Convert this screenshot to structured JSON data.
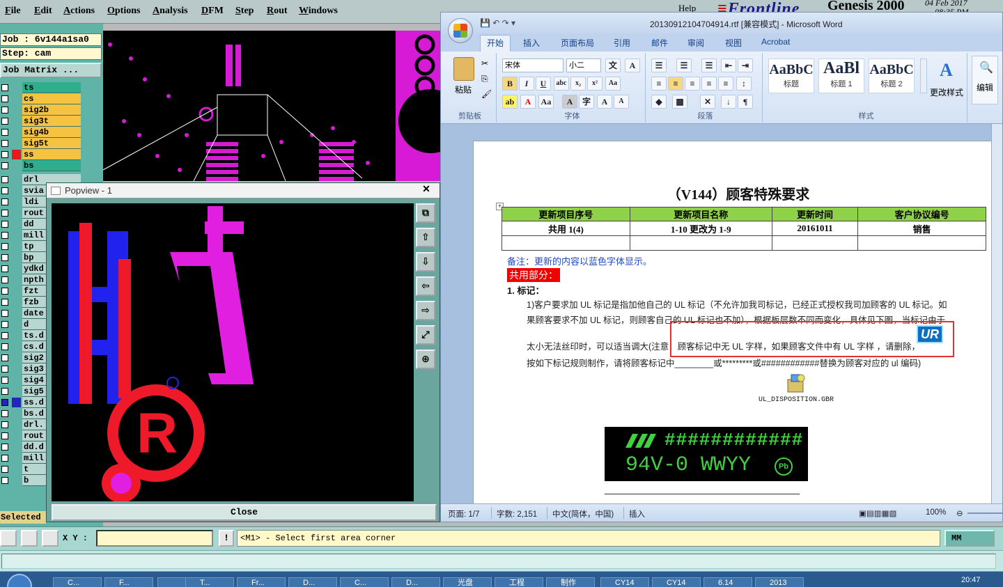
{
  "genesis": {
    "menu": [
      "File",
      "Edit",
      "Actions",
      "Options",
      "Analysis",
      "DFM",
      "Step",
      "Rout",
      "Windows"
    ],
    "brand": {
      "help": "Help",
      "logo": "Frontline",
      "product": "Genesis 2000",
      "date": "04 Feb 2017",
      "time": "08:35 PM"
    },
    "job_label": "Job : 6v144a1sa0",
    "step_label": "Step: cam",
    "job_matrix_button": "Job Matrix ...",
    "layers": [
      {
        "name": "ts",
        "color": "#2fae8e",
        "checked": false
      },
      {
        "name": "cs",
        "color": "#f5c242",
        "checked": false
      },
      {
        "name": "sig2b",
        "color": "#f5c242",
        "checked": false
      },
      {
        "name": "sig3t",
        "color": "#f5c242",
        "checked": false
      },
      {
        "name": "sig4b",
        "color": "#f5c242",
        "checked": false
      },
      {
        "name": "sig5t",
        "color": "#f5c242",
        "checked": false
      },
      {
        "name": "ss",
        "color": "#f5c242",
        "checked": false,
        "highlight": "#e81919"
      },
      {
        "name": "bs",
        "color": "#2fae8e",
        "checked": false
      },
      {
        "name": "drl",
        "color": "#b9d6d0",
        "checked": false
      },
      {
        "name": "svia",
        "color": "#b9d6d0",
        "checked": false
      },
      {
        "name": "ldi",
        "color": "#b9d6d0",
        "checked": false
      },
      {
        "name": "rout",
        "color": "#b9d6d0",
        "checked": false
      },
      {
        "name": "dd",
        "color": "#b9d6d0",
        "checked": false
      },
      {
        "name": "mill",
        "color": "#b9d6d0",
        "checked": false
      },
      {
        "name": "tp",
        "color": "#b9d6d0",
        "checked": false
      },
      {
        "name": "bp",
        "color": "#b9d6d0",
        "checked": false
      },
      {
        "name": "ydkd",
        "color": "#b9d6d0",
        "checked": false
      },
      {
        "name": "npth",
        "color": "#b9d6d0",
        "checked": false
      },
      {
        "name": "fzt",
        "color": "#b9d6d0",
        "checked": false
      },
      {
        "name": "fzb",
        "color": "#b9d6d0",
        "checked": false
      },
      {
        "name": "date",
        "color": "#b9d6d0",
        "checked": false
      },
      {
        "name": "d",
        "color": "#b9d6d0",
        "checked": false
      },
      {
        "name": "ts.d",
        "color": "#b9d6d0",
        "checked": false
      },
      {
        "name": "cs.d",
        "color": "#b9d6d0",
        "checked": false
      },
      {
        "name": "sig2",
        "color": "#b9d6d0",
        "checked": false
      },
      {
        "name": "sig3",
        "color": "#b9d6d0",
        "checked": false
      },
      {
        "name": "sig4",
        "color": "#b9d6d0",
        "checked": false
      },
      {
        "name": "sig5",
        "color": "#b9d6d0",
        "checked": false
      },
      {
        "name": "ss.d",
        "color": "#b9d6d0",
        "checked": true,
        "highlight": "#2424c0"
      },
      {
        "name": "bs.d",
        "color": "#b9d6d0",
        "checked": false
      },
      {
        "name": "drl.",
        "color": "#b9d6d0",
        "checked": false
      },
      {
        "name": "rout",
        "color": "#b9d6d0",
        "checked": false
      },
      {
        "name": "dd.d",
        "color": "#b9d6d0",
        "checked": false
      },
      {
        "name": "mill",
        "color": "#b9d6d0",
        "checked": false
      },
      {
        "name": "t",
        "color": "#b9d6d0",
        "checked": false
      },
      {
        "name": "b",
        "color": "#b9d6d0",
        "checked": false
      }
    ],
    "selected_label": "Selected",
    "popview": {
      "title": "Popview - 1",
      "close_label": "Close",
      "tools": [
        "fit-icon",
        "pan-up-icon",
        "pan-down-icon",
        "pan-left-icon",
        "pan-right-icon",
        "zoom-fit-icon",
        "zoom-icon"
      ]
    },
    "status": {
      "xy_label": "X Y :",
      "xy_value": "",
      "bang": "!",
      "message": "<M1> - Select first area corner",
      "unit": "MM"
    }
  },
  "word": {
    "title": "20130912104704914.rtf [兼容模式] - Microsoft Word",
    "tabs": [
      "开始",
      "插入",
      "页面布局",
      "引用",
      "邮件",
      "审阅",
      "视图",
      "Acrobat"
    ],
    "ribbon": {
      "paste": "粘贴",
      "clipboard": "剪贴板",
      "font_name": "宋体",
      "font_size": "小二",
      "font_group": "字体",
      "paragraph_group": "段落",
      "styles_group": "样式",
      "styles": [
        {
          "sample": "AaBbC",
          "name": "标题"
        },
        {
          "sample": "AaBl",
          "name": "标题 1"
        },
        {
          "sample": "AaBbC",
          "name": "标题 2"
        }
      ],
      "change_styles": "更改样式",
      "editing": "编辑"
    },
    "document": {
      "title": "（V144）顾客特殊要求",
      "table_headers": [
        "更新项目序号",
        "更新项目名称",
        "更新时间",
        "客户协议编号"
      ],
      "table_rows": [
        [
          "共用 1(4)",
          "1-10 更改为 1-9",
          "20161011",
          "销售"
        ],
        [
          "",
          "",
          "",
          ""
        ]
      ],
      "note": "备注：更新的内容以蓝色字体显示。",
      "common": "共用部分：",
      "section1": "1.   标记：",
      "para1": "1)客户要求加 UL 标记是指加他自己的 UL 标记（不允许加我司标记，已经正式授权我司加顾客的 UL 标记。如",
      "para2": "果顾客要求不加 UL 标记，则顾客自己的 UL 标记也不加），根据板层数不同而变化，具体见下图，当标记由于",
      "para3": "太小无法丝印时，可以适当调大(注意：顾客标记中无 UL 字样，如果顾客文件中有 UL 字样       ，请删除，",
      "para4": "按如下标记规则制作，请将顾客标记中________或*********或############替换为顾客对应的 ul 编码)",
      "attachment": "UL_DISPOSITION.GBR",
      "marking_line1": "############",
      "marking_line2": "94V-0 WWYY",
      "marking_pb": "Pb"
    },
    "statusbar": {
      "page": "页面: 1/7",
      "words": "字数: 2,151",
      "language": "中文(简体，中国)",
      "mode": "插入",
      "zoom": "100%"
    }
  },
  "taskbar": {
    "items": [
      "C...",
      "F...",
      "",
      "T...",
      "Fr...",
      "D...",
      "C...",
      "D...",
      "光盘",
      "工程",
      "制作",
      "CY14",
      "CY14",
      "6.14",
      "2013"
    ],
    "clock": "20:47"
  }
}
